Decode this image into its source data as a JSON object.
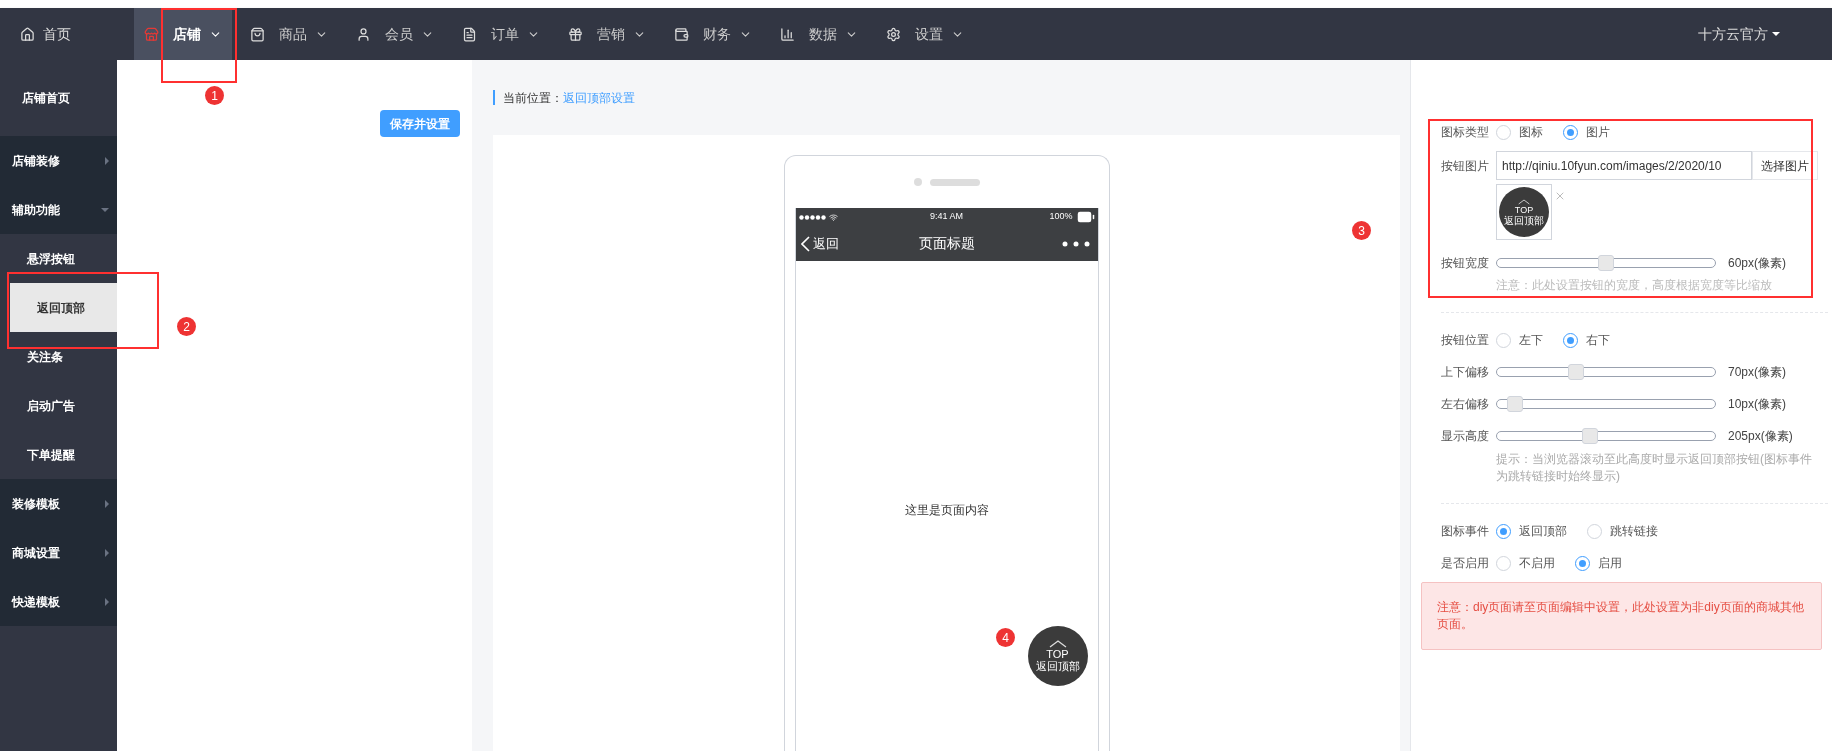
{
  "nav": {
    "home": "首页",
    "menus": [
      {
        "label": "店铺",
        "selected": true
      },
      {
        "label": "商品",
        "selected": false
      },
      {
        "label": "会员",
        "selected": false
      },
      {
        "label": "订单",
        "selected": false
      },
      {
        "label": "营销",
        "selected": false
      },
      {
        "label": "财务",
        "selected": false
      },
      {
        "label": "数据",
        "selected": false
      },
      {
        "label": "设置",
        "selected": false
      }
    ],
    "user": "十方云官方"
  },
  "sidebar": {
    "home": "店铺首页",
    "groups": [
      {
        "label": "店铺装修",
        "expanded": false
      },
      {
        "label": "辅助功能",
        "expanded": true,
        "children": [
          {
            "label": "悬浮按钮",
            "selected": false
          },
          {
            "label": "返回顶部",
            "selected": true
          },
          {
            "label": "关注条",
            "selected": false
          },
          {
            "label": "启动广告",
            "selected": false
          },
          {
            "label": "下单提醒",
            "selected": false
          }
        ]
      },
      {
        "label": "装修模板",
        "expanded": false
      },
      {
        "label": "商城设置",
        "expanded": false
      },
      {
        "label": "快递模板",
        "expanded": false
      }
    ]
  },
  "save_button": "保存并设置",
  "breadcrumb": {
    "label": "当前位置：",
    "link": "返回顶部设置"
  },
  "phone": {
    "time": "9:41 AM",
    "battery": "100%",
    "back": "返回",
    "title": "页面标题",
    "content": "这里是页面内容",
    "float_button": {
      "top": "TOP",
      "label": "返回顶部"
    }
  },
  "settings": {
    "icon_type": {
      "label": "图标类型",
      "options": [
        {
          "label": "图标",
          "selected": false
        },
        {
          "label": "图片",
          "selected": true
        }
      ]
    },
    "button_image": {
      "label": "按钮图片",
      "url": "http://qiniu.10fyun.com/images/2/2020/10",
      "choose": "选择图片",
      "preview": {
        "top": "TOP",
        "label": "返回顶部"
      }
    },
    "width": {
      "label": "按钮宽度",
      "level": 0.5,
      "reading": "60px(像素)",
      "note": "注意：此处设置按钮的宽度，高度根据宽度等比缩放"
    },
    "position": {
      "label": "按钮位置",
      "options": [
        {
          "label": "左下",
          "selected": false
        },
        {
          "label": "右下",
          "selected": true
        }
      ]
    },
    "offsets": [
      {
        "label": "上下偏移",
        "level": 0.35,
        "reading": "70px(像素)"
      },
      {
        "label": "左右偏移",
        "level": 0.05,
        "reading": "10px(像素)"
      },
      {
        "label": "显示高度",
        "level": 0.42,
        "reading": "205px(像素)",
        "note": "提示：当浏览器滚动至此高度时显示返回顶部按钮(图标事件为跳转链接时始终显示)"
      }
    ],
    "event": {
      "label": "图标事件",
      "options": [
        {
          "label": "返回顶部",
          "selected": true
        },
        {
          "label": "跳转链接",
          "selected": false
        }
      ]
    },
    "enabled": {
      "label": "是否启用",
      "options": [
        {
          "label": "不启用",
          "selected": false
        },
        {
          "label": "启用",
          "selected": true
        }
      ]
    },
    "alert": "注意：diy页面请至页面编辑中设置，此处设置为非diy页面的商城其他页面。"
  },
  "annotations": [
    "1",
    "2",
    "3",
    "4"
  ]
}
